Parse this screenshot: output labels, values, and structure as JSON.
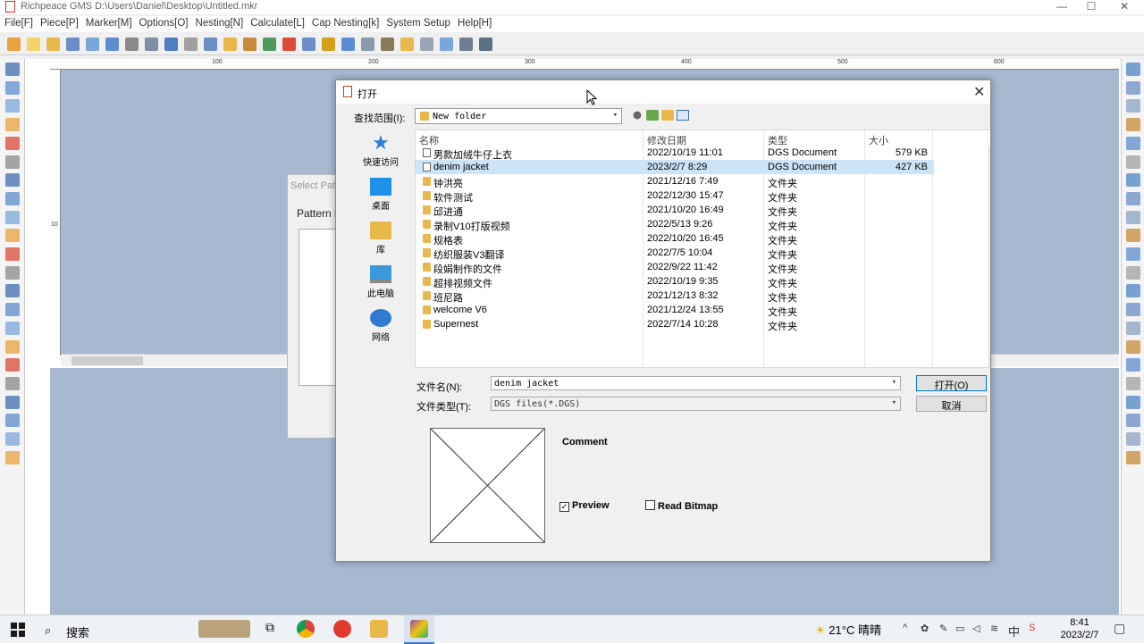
{
  "window": {
    "title": "Richpeace GMS D:\\Users\\Daniel\\Desktop\\Untitled.mkr",
    "min": "—",
    "max": "☐",
    "close": "✕"
  },
  "menu": [
    "File[F]",
    "Piece[P]",
    "Marker[M]",
    "Options[O]",
    "Nesting[N]",
    "Calculate[L]",
    "Cap Nesting[k]",
    "System Setup",
    "Help[H]"
  ],
  "ruler": {
    "top_ticks": [
      "100",
      "200",
      "300",
      "400",
      "500",
      "600"
    ],
    "left_ticks": [
      "10"
    ]
  },
  "background_dialog": {
    "title": "Select Patt",
    "label": "Pattern l"
  },
  "dialog": {
    "title": "打开",
    "look_in_label": "查找范围(I):",
    "look_in_value": "New folder",
    "places": [
      "快速访问",
      "桌面",
      "库",
      "此电脑",
      "网络"
    ],
    "columns": {
      "name": "名称",
      "date": "修改日期",
      "type": "类型",
      "size": "大小"
    },
    "files": [
      {
        "name": "男款加绒牛仔上衣",
        "date": "2022/10/19 11:01",
        "type": "DGS Document",
        "size": "579 KB",
        "kind": "doc",
        "selected": false
      },
      {
        "name": "denim jacket",
        "date": "2023/2/7 8:29",
        "type": "DGS Document",
        "size": "427 KB",
        "kind": "doc",
        "selected": true
      },
      {
        "name": "钟洪亮",
        "date": "2021/12/16 7:49",
        "type": "文件夹",
        "size": "",
        "kind": "folder",
        "selected": false
      },
      {
        "name": "软件测试",
        "date": "2022/12/30 15:47",
        "type": "文件夹",
        "size": "",
        "kind": "folder",
        "selected": false
      },
      {
        "name": "邱进通",
        "date": "2021/10/20 16:49",
        "type": "文件夹",
        "size": "",
        "kind": "folder",
        "selected": false
      },
      {
        "name": "录制V10打版视频",
        "date": "2022/5/13 9:26",
        "type": "文件夹",
        "size": "",
        "kind": "folder",
        "selected": false
      },
      {
        "name": "规格表",
        "date": "2022/10/20 16:45",
        "type": "文件夹",
        "size": "",
        "kind": "folder",
        "selected": false
      },
      {
        "name": "纺织服装V3翻译",
        "date": "2022/7/5 10:04",
        "type": "文件夹",
        "size": "",
        "kind": "folder",
        "selected": false
      },
      {
        "name": "段娟制作的文件",
        "date": "2022/9/22 11:42",
        "type": "文件夹",
        "size": "",
        "kind": "folder",
        "selected": false
      },
      {
        "name": "超排视频文件",
        "date": "2022/10/19 9:35",
        "type": "文件夹",
        "size": "",
        "kind": "folder",
        "selected": false
      },
      {
        "name": "班尼路",
        "date": "2021/12/13 8:32",
        "type": "文件夹",
        "size": "",
        "kind": "folder",
        "selected": false
      },
      {
        "name": "welcome V6",
        "date": "2021/12/24 13:55",
        "type": "文件夹",
        "size": "",
        "kind": "folder",
        "selected": false
      },
      {
        "name": "Supernest",
        "date": "2022/7/14 10:28",
        "type": "文件夹",
        "size": "",
        "kind": "folder",
        "selected": false
      }
    ],
    "filename_label": "文件名(N):",
    "filename_value": "denim jacket",
    "filetype_label": "文件类型(T):",
    "filetype_value": "DGS files(*.DGS)",
    "open_button": "打开(O)",
    "cancel_button": "取消",
    "comment_label": "Comment",
    "preview_label": "Preview",
    "preview_checked": true,
    "read_bitmap_label": "Read Bitmap",
    "read_bitmap_checked": false
  },
  "taskbar": {
    "search_placeholder": "搜索",
    "weather": "21°C 晴晴",
    "ime": "中",
    "time": "8:41",
    "date": "2023/2/7"
  },
  "colors": {
    "workspace": "#a6b9d0",
    "selection": "#cce4f7",
    "accent": "#0078d7"
  }
}
